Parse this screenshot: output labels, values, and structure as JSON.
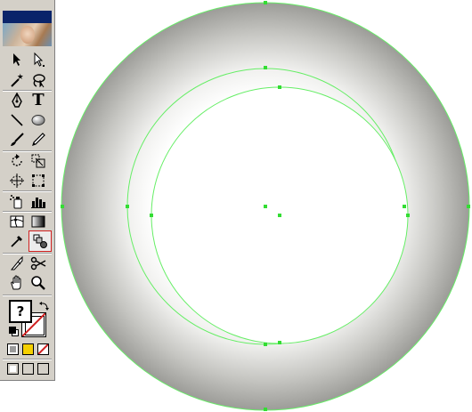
{
  "toolbox": {
    "tools": [
      {
        "name": "selection-tool-icon"
      },
      {
        "name": "direct-selection-tool-icon"
      },
      {
        "name": "magic-wand-tool-icon"
      },
      {
        "name": "lasso-tool-icon"
      },
      {
        "name": "pen-tool-icon"
      },
      {
        "name": "type-tool-icon",
        "glyph": "T"
      },
      {
        "name": "line-tool-icon"
      },
      {
        "name": "ellipse-tool-icon"
      },
      {
        "name": "paintbrush-tool-icon"
      },
      {
        "name": "pencil-tool-icon"
      },
      {
        "name": "rotate-tool-icon"
      },
      {
        "name": "scale-tool-icon"
      },
      {
        "name": "warp-tool-icon"
      },
      {
        "name": "free-transform-tool-icon"
      },
      {
        "name": "symbol-sprayer-tool-icon"
      },
      {
        "name": "graph-tool-icon"
      },
      {
        "name": "mesh-tool-icon"
      },
      {
        "name": "gradient-tool-icon"
      },
      {
        "name": "eyedropper-tool-icon"
      },
      {
        "name": "blend-tool-icon"
      },
      {
        "name": "slice-tool-icon"
      },
      {
        "name": "scissors-tool-icon"
      },
      {
        "name": "hand-tool-icon"
      },
      {
        "name": "zoom-tool-icon"
      }
    ],
    "fill_stroke": {
      "fill_glyph": "?"
    },
    "colors": {
      "titlebar": "#0a246a",
      "panel": "#d4d0c8",
      "fill_swatch_yellow": "#f5d000"
    }
  },
  "canvas": {
    "path_color": "#66ee66",
    "ring_gradient": [
      "#ffffff",
      "#f2f2f0",
      "#c8c8c4",
      "#9a9a96"
    ]
  }
}
